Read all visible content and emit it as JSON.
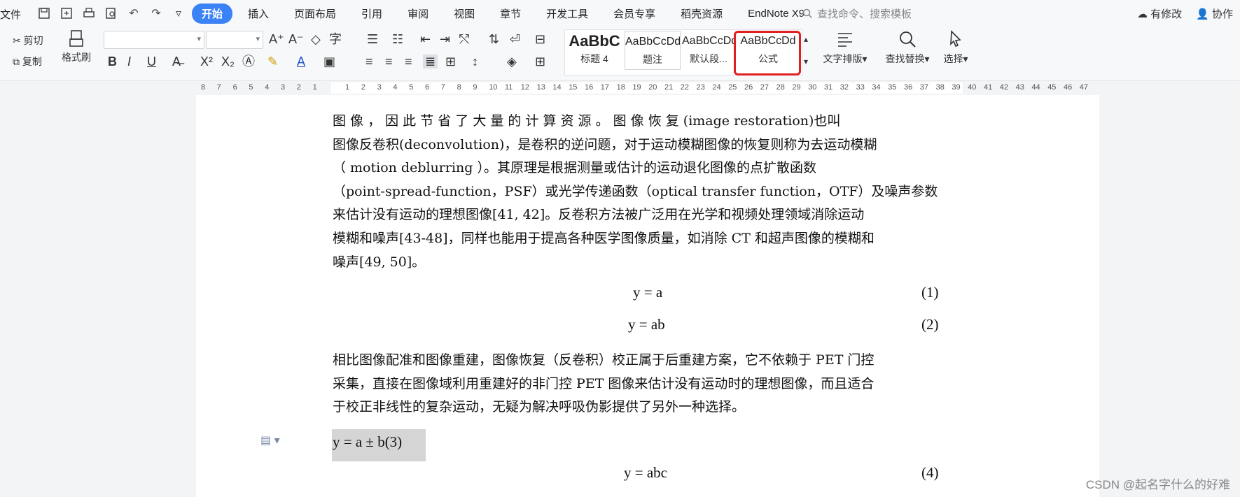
{
  "menubar": {
    "file": "文件",
    "tabs": [
      "开始",
      "插入",
      "页面布局",
      "引用",
      "审阅",
      "视图",
      "章节",
      "开发工具",
      "会员专享",
      "稻壳资源",
      "EndNote X9"
    ],
    "search_placeholder": "查找命令、搜索模板",
    "has_changes": "有修改",
    "collaborate": "协作"
  },
  "ribbon": {
    "cut": "剪切",
    "copy": "复制",
    "format_painter": "格式刷",
    "styles": [
      {
        "preview": "AaBbC",
        "label": "标题 4"
      },
      {
        "preview": "AaBbCcDd",
        "label": "题注"
      },
      {
        "preview": "AaBbCcDd",
        "label": "默认段..."
      },
      {
        "preview": "AaBbCcDd",
        "label": "公式"
      }
    ],
    "text_layout": "文字排版",
    "find_replace": "查找替换",
    "select": "选择"
  },
  "ruler": {
    "left_numbers": [
      "8",
      "7",
      "6",
      "5",
      "4",
      "3",
      "2",
      "1"
    ],
    "right_numbers": [
      "1",
      "2",
      "3",
      "4",
      "5",
      "6",
      "7",
      "8",
      "9",
      "10",
      "11",
      "12",
      "13",
      "14",
      "15",
      "16",
      "17",
      "18",
      "19",
      "20",
      "21",
      "22",
      "23",
      "24",
      "25",
      "26",
      "27",
      "28",
      "29",
      "30",
      "31",
      "32",
      "33",
      "34",
      "35",
      "36",
      "37",
      "38",
      "39",
      "40",
      "41",
      "42",
      "43",
      "44",
      "45",
      "46",
      "47"
    ]
  },
  "document": {
    "para1": [
      "图 像 ， 因 此 节 省 了 大 量 的 计 算 资 源 。 图 像 恢 复 (image restoration)也叫",
      "图像反卷积(deconvolution)，是卷积的逆问题，对于运动模糊图像的恢复则称为去运动模糊",
      "（ motion    deblurring ）。其原理是根据测量或估计的运动退化图像的点扩散函数",
      "（point-spread-function，PSF）或光学传递函数（optical transfer function，OTF）及噪声参数",
      "来估计没有运动的理想图像[41,   42]。反卷积方法被广泛用在光学和视频处理领域消除运动",
      "模糊和噪声[43-48]，同样也能用于提高各种医学图像质量，如消除 CT 和超声图像的模糊和",
      "噪声[49, 50]。"
    ],
    "eq1": "y = a",
    "eq1_num": "(1)",
    "eq2": "y = ab",
    "eq2_num": "(2)",
    "para2": [
      "相比图像配准和图像重建，图像恢复（反卷积）校正属于后重建方案，它不依赖于 PET 门控",
      "采集，直接在图像域利用重建好的非门控 PET 图像来估计没有运动时的理想图像，而且适合",
      "于校正非线性的复杂运动，无疑为解决呼吸伪影提供了另外一种选择。"
    ],
    "eq3": "y = a ± b(3)",
    "eq4": "y = abc",
    "eq4_num": "(4)"
  },
  "watermark": "CSDN @起名字什么的好难"
}
